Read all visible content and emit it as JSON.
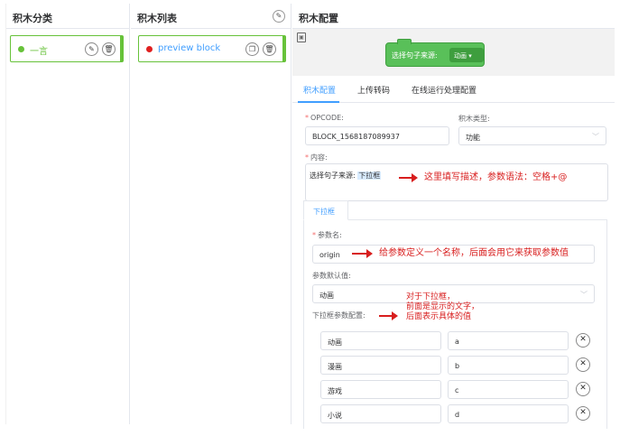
{
  "category_panel": {
    "title": "积木分类",
    "items": [
      {
        "label": "一言",
        "dot_color": "#67c23a"
      }
    ]
  },
  "list_panel": {
    "title": "积木列表",
    "items": [
      {
        "label": "preview block",
        "dot_color": "#e02020"
      }
    ]
  },
  "config_panel": {
    "title": "积木配置",
    "block_preview": {
      "text": "选择句子来源:",
      "dropdown_value": "动画"
    },
    "tabs": [
      {
        "label": "积木配置",
        "active": true
      },
      {
        "label": "上传转码"
      },
      {
        "label": "在线运行处理配置"
      }
    ],
    "form": {
      "opcode_label": "OPCODE:",
      "opcode_value": "BLOCK_1568187089937",
      "type_label": "积木类型:",
      "type_value": "功能",
      "content_label": "内容:",
      "content_text": "选择句子来源:",
      "content_param": "下拉框",
      "subtab_label": "下拉框",
      "param_name_label": "参数名:",
      "param_name_value": "origin",
      "default_label": "参数默认值:",
      "default_value": "动画",
      "options_label": "下拉框参数配置:",
      "options": [
        {
          "name": "动画",
          "value": "a"
        },
        {
          "name": "漫画",
          "value": "b"
        },
        {
          "name": "游戏",
          "value": "c"
        },
        {
          "name": "小说",
          "value": "d"
        }
      ]
    }
  },
  "annotations": {
    "content_note": "这里填写描述，参数语法：空格+@",
    "param_note": "给参数定义一个名称，后面会用它来获取参数值",
    "options_note_1": "对于下拉框，",
    "options_note_2": "前面是显示的文字，",
    "options_note_3": "后面表示具体的值"
  },
  "colors": {
    "accent": "#409eff",
    "block_green": "#59c059",
    "card_border": "#67c23a",
    "annotation": "#d81e1e"
  }
}
